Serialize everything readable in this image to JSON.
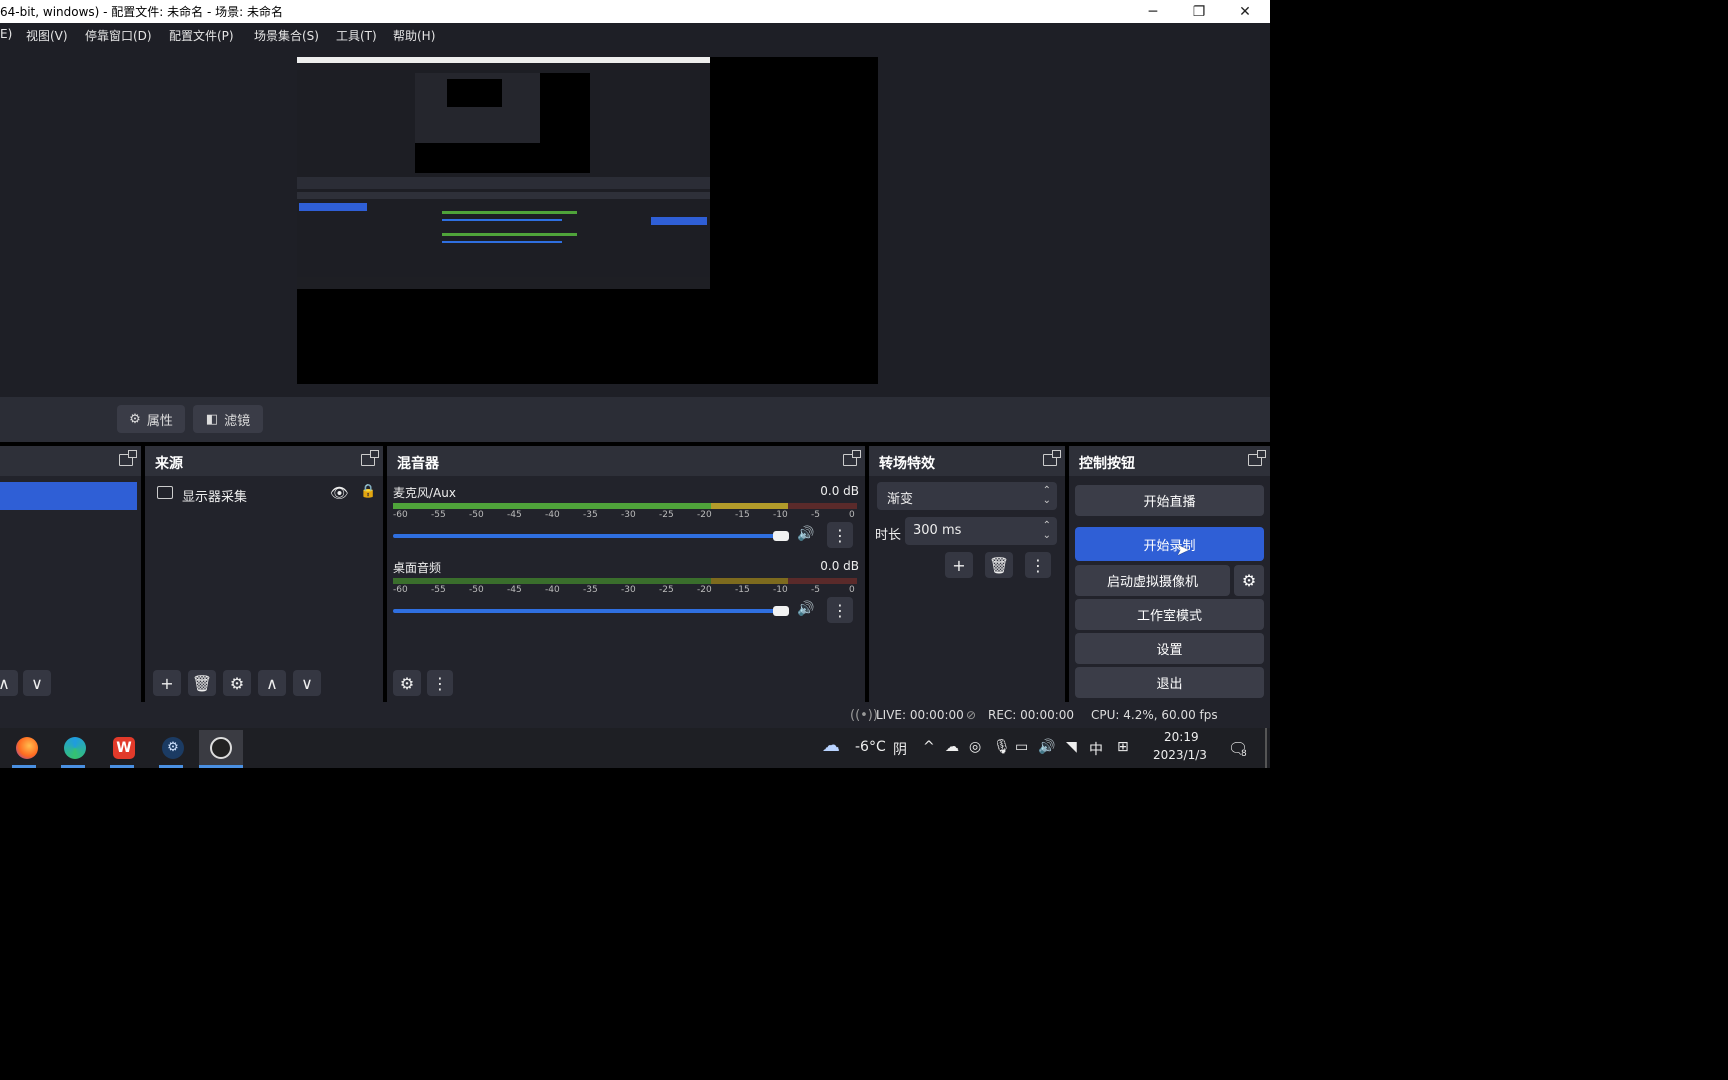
{
  "window": {
    "title": "64-bit, windows) - 配置文件: 未命名 - 场景: 未命名",
    "controls": {
      "minimize": "─",
      "maximize": "❐",
      "close": "✕"
    }
  },
  "menu": [
    {
      "label": "E)"
    },
    {
      "label": "视图(V)"
    },
    {
      "label": "停靠窗口(D)"
    },
    {
      "label": "配置文件(P)"
    },
    {
      "label": "场景集合(S)"
    },
    {
      "label": "工具(T)"
    },
    {
      "label": "帮助(H)"
    }
  ],
  "toolbar": {
    "properties_label": "属性",
    "filters_label": "滤镜"
  },
  "sources": {
    "title": "来源",
    "items": [
      {
        "label": "显示器采集"
      }
    ]
  },
  "mixer": {
    "title": "混音器",
    "channels": [
      {
        "name": "麦克风/Aux",
        "level": "0.0 dB",
        "volume_pct": 100
      },
      {
        "name": "桌面音频",
        "level": "0.0 dB",
        "volume_pct": 100
      }
    ],
    "ticks": [
      "-60",
      "-55",
      "-50",
      "-45",
      "-40",
      "-35",
      "-30",
      "-25",
      "-20",
      "-15",
      "-10",
      "-5",
      "0"
    ]
  },
  "transitions": {
    "title": "转场特效",
    "selected": "渐变",
    "duration_label": "时长",
    "duration_value": "300 ms"
  },
  "controls": {
    "title": "控制按钮",
    "start_stream": "开始直播",
    "start_record": "开始录制",
    "virtual_cam": "启动虚拟摄像机",
    "studio_mode": "工作室模式",
    "settings": "设置",
    "exit": "退出"
  },
  "status": {
    "live": "LIVE: 00:00:00",
    "rec": "REC: 00:00:00",
    "cpu": "CPU: 4.2%, 60.00 fps"
  },
  "taskbar": {
    "apps": [
      {
        "icon": "firefox-icon"
      },
      {
        "icon": "edge-icon"
      },
      {
        "icon": "wps-icon"
      },
      {
        "icon": "steam-icon"
      },
      {
        "icon": "obs-icon"
      }
    ],
    "weather": "-6°C",
    "weather_desc": "阴",
    "ime": "中",
    "time": "20:19",
    "date": "2023/1/3",
    "notification_count": "8"
  },
  "colors": {
    "accent": "#2f5fd6",
    "panel": "#22232b",
    "dock_header": "#2e3039",
    "meter_green": "#4fa33a",
    "meter_yellow": "#b39b2a",
    "meter_red": "#9a2b2b"
  }
}
